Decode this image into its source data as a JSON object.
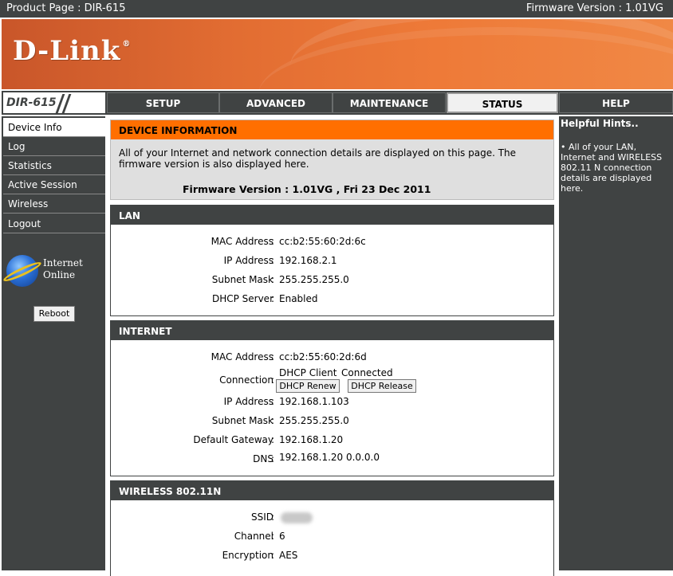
{
  "header": {
    "product_page": "Product Page : DIR-615",
    "firmware": "Firmware Version : 1.01VG"
  },
  "brand": {
    "logo": "D-Link",
    "reg": "®"
  },
  "model": "DIR-615",
  "tabs": [
    "SETUP",
    "ADVANCED",
    "MAINTENANCE",
    "STATUS",
    "HELP"
  ],
  "active_tab": "STATUS",
  "sidebar": {
    "items": [
      "Device Info",
      "Log",
      "Statistics",
      "Active Session",
      "Wireless",
      "Logout"
    ],
    "active": "Device Info",
    "status_line1": "Internet",
    "status_line2": "Online",
    "reboot": "Reboot"
  },
  "device_info": {
    "title": "DEVICE INFORMATION",
    "description": "All of your Internet and network connection details are displayed on this page. The firmware version is also displayed here.",
    "firmware": "Firmware Version  :  1.01VG , Fri 23 Dec 2011"
  },
  "lan": {
    "title": "LAN",
    "rows": [
      {
        "label": "MAC Address",
        "value": "cc:b2:55:60:2d:6c"
      },
      {
        "label": "IP Address",
        "value": "192.168.2.1"
      },
      {
        "label": "Subnet Mask",
        "value": "255.255.255.0"
      },
      {
        "label": "DHCP Server",
        "value": "Enabled"
      }
    ]
  },
  "internet": {
    "title": "INTERNET",
    "mac": {
      "label": "MAC Address",
      "value": "cc:b2:55:60:2d:6d"
    },
    "connection": {
      "label": "Connection",
      "type": "DHCP Client",
      "status": "Connected",
      "renew": "DHCP Renew",
      "release": "DHCP Release"
    },
    "rows": [
      {
        "label": "IP Address",
        "value": "192.168.1.103"
      },
      {
        "label": "Subnet Mask",
        "value": "255.255.255.0"
      },
      {
        "label": "Default Gateway",
        "value": "192.168.1.20"
      },
      {
        "label": "DNS",
        "value": "192.168.1.20 0.0.0.0"
      }
    ]
  },
  "wireless": {
    "title": "WIRELESS 802.11N",
    "rows": [
      {
        "label": "SSID",
        "value": ""
      },
      {
        "label": "Channel",
        "value": "6"
      },
      {
        "label": "Encryption",
        "value": "AES"
      }
    ]
  },
  "help": {
    "title": "Helpful Hints..",
    "text": "•  All of your LAN, Internet and WIRELESS 802.11 N connection details are displayed here."
  },
  "colors": {
    "orange": "#ff6f00",
    "dark": "#404343"
  }
}
